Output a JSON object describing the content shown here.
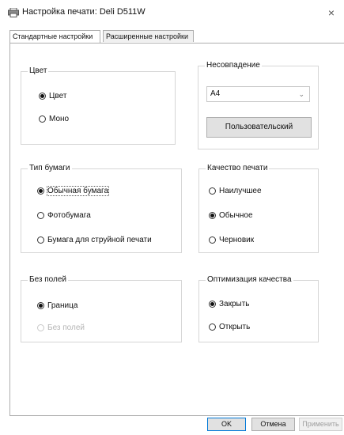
{
  "window": {
    "title": "Настройка печати: Deli D511W",
    "close_symbol": "×"
  },
  "tabs": [
    "Стандартные настройки",
    "Расширенные настройки"
  ],
  "groups": {
    "color": {
      "title": "Цвет",
      "options": [
        "Цвет",
        "Моно"
      ],
      "selected": "Цвет"
    },
    "mismatch": {
      "title": "Несовпадение",
      "paper_size": "A4",
      "custom_button": "Пользовательский"
    },
    "paper_type": {
      "title": "Тип бумаги",
      "options": [
        "Обычная бумага",
        "Фотобумага",
        "Бумага для струйной печати"
      ],
      "selected": "Обычная бумага"
    },
    "print_quality": {
      "title": "Качество печати",
      "options": [
        "Наилучшее",
        "Обычное",
        "Черновик"
      ],
      "selected": "Обычное"
    },
    "borderless": {
      "title": "Без полей",
      "options": [
        "Граница",
        "Без полей"
      ],
      "selected": "Граница",
      "disabled_option": "Без полей"
    },
    "quality_optimization": {
      "title": "Оптимизация качества",
      "options": [
        "Закрыть",
        "Открыть"
      ],
      "selected": "Закрыть"
    }
  },
  "buttons": {
    "ok": "OK",
    "cancel": "Отмена",
    "apply": "Применить"
  },
  "colors": {
    "panel_border": "#adadad",
    "group_border": "#d6d6d6",
    "ok_border": "#0078d7"
  }
}
